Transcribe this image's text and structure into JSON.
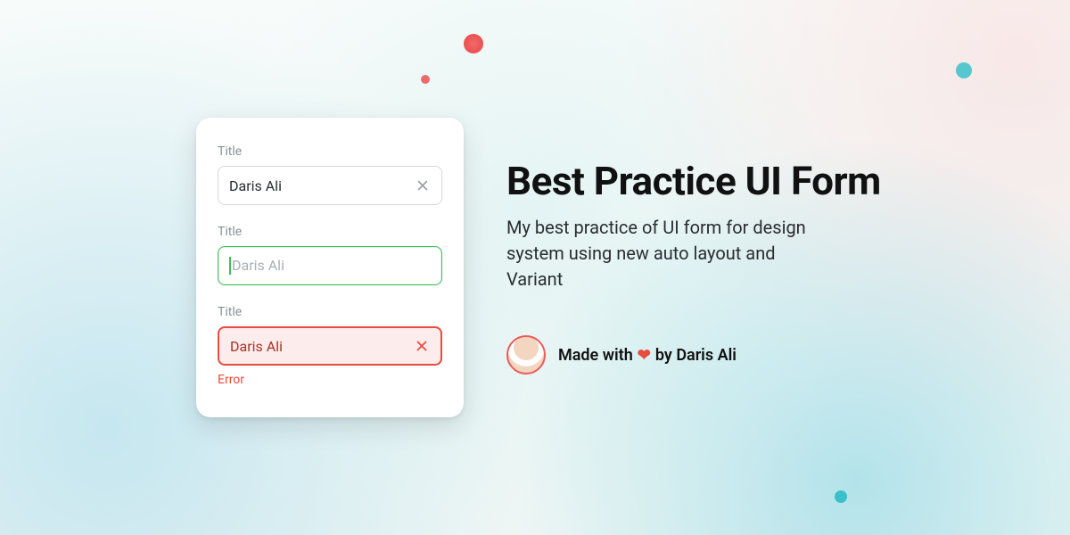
{
  "form": {
    "fields": [
      {
        "label": "Title",
        "value": "Daris Ali",
        "state": "default"
      },
      {
        "label": "Title",
        "placeholder": "Daris Ali",
        "state": "success"
      },
      {
        "label": "Title",
        "value": "Daris Ali",
        "state": "error",
        "error_text": "Error"
      }
    ]
  },
  "copy": {
    "headline": "Best Practice UI Form",
    "sub": "My best practice of UI form for design system using new auto layout and Variant",
    "byline_prefix": "Made with",
    "byline_heart": "❤",
    "byline_suffix": "by Daris Ali"
  }
}
